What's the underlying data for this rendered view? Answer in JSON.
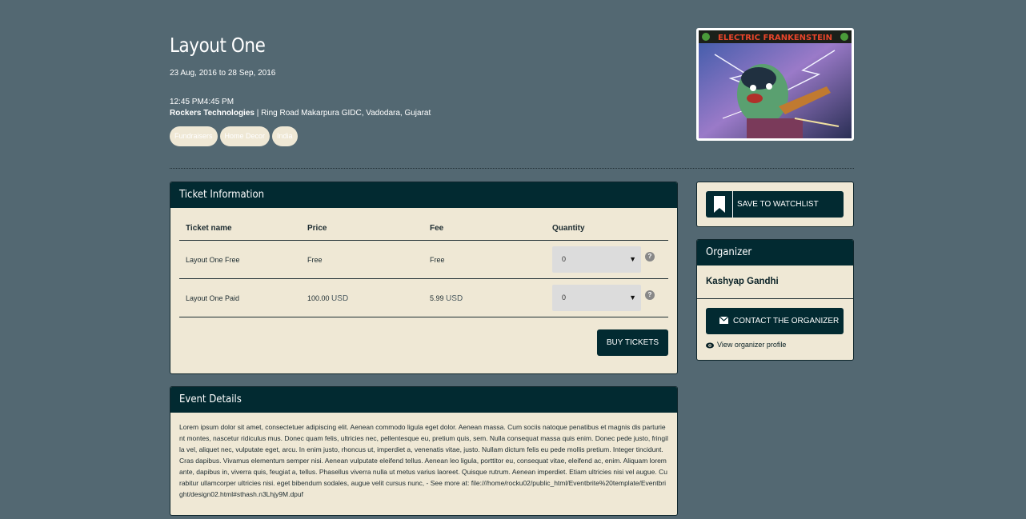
{
  "event": {
    "title": "Layout One",
    "dates": "23 Aug, 2016 to 28 Sep, 2016",
    "time": "12:45 PM4:45 PM",
    "venue_name": "Rockers Technologies",
    "venue_address": " | Ring Road Makarpura GIDC, Vadodara, Gujarat",
    "tags": [
      "Fundraisers",
      "Home Decor",
      "India"
    ],
    "image_caption": "ELECTRIC FRANKENSTEIN"
  },
  "tickets": {
    "heading": "Ticket Information",
    "columns": [
      "Ticket name",
      "Price",
      "Fee",
      "Quantity"
    ],
    "rows": [
      {
        "name": "Layout One Free",
        "price": "Free",
        "price_currency": "",
        "fee": "Free",
        "fee_currency": "",
        "quantity": "0"
      },
      {
        "name": "Layout One Paid",
        "price": "100.00",
        "price_currency": "USD",
        "fee": "5.99",
        "fee_currency": "USD",
        "quantity": "0"
      }
    ],
    "help_glyph": "?",
    "buy_label": "BUY TICKETS"
  },
  "details": {
    "heading": "Event Details",
    "body": "Lorem ipsum dolor sit amet, consectetuer adipiscing elit. Aenean commodo ligula eget dolor. Aenean massa. Cum sociis natoque penatibus et magnis dis parturient montes, nascetur ridiculus mus. Donec quam felis, ultricies nec, pellentesque eu, pretium quis, sem. Nulla consequat massa quis enim. Donec pede justo, fringilla vel, aliquet nec, vulputate eget, arcu. In enim justo, rhoncus ut, imperdiet a, venenatis vitae, justo. Nullam dictum felis eu pede mollis pretium. Integer tincidunt. Cras dapibus. Vivamus elementum semper nisi. Aenean vulputate eleifend tellus. Aenean leo ligula, porttitor eu, consequat vitae, eleifend ac, enim. Aliquam lorem ante, dapibus in, viverra quis, feugiat a, tellus. Phasellus viverra nulla ut metus varius laoreet. Quisque rutrum. Aenean imperdiet. Etiam ultricies nisi vel augue. Curabitur ullamcorper ultricies nisi. eget bibendum sodales, augue velit cursus nunc, - See more at: file:///home/rocku02/public_html/Eventbrite%20template/Eventbright/design02.html#sthash.n3Lhjy9M.dpuf"
  },
  "sidebar": {
    "watchlist_label": "SAVE TO WATCHLIST",
    "organizer_heading": "Organizer",
    "organizer_name": "Kashyap Gandhi",
    "contact_label": "CONTACT THE ORGANIZER",
    "profile_link": "View organizer profile"
  },
  "colors": {
    "page_bg": "#536872",
    "panel_bg": "#efe8d5",
    "header_bg": "#022a31",
    "accent": "#022a31"
  },
  "icons": {
    "watchlist": "bookmark-icon",
    "contact": "envelope-icon",
    "profile": "eye-icon",
    "help": "question-icon",
    "select": "caret-down-icon"
  }
}
